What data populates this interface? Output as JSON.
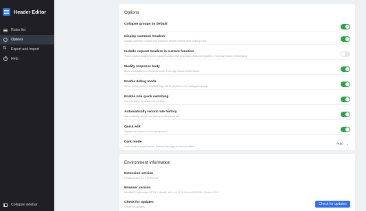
{
  "app": {
    "title": "Header Editor"
  },
  "sidebar": {
    "items": [
      {
        "label": "Rules list",
        "icon": "list-icon",
        "active": false
      },
      {
        "label": "Options",
        "icon": "gear-icon",
        "active": true
      },
      {
        "label": "Export and import",
        "icon": "swap-icon",
        "active": false
      },
      {
        "label": "Help",
        "icon": "help-icon",
        "active": false
      }
    ],
    "collapse_label": "Collapse sidebar"
  },
  "options": {
    "title": "Options",
    "items": [
      {
        "label": "Collapse groups by default",
        "desc": "",
        "enabled": true
      },
      {
        "label": "Display common headers",
        "desc": "Display common request and response header names when editing rules",
        "enabled": true
      },
      {
        "label": "Include request headers in custom function",
        "desc": "Pass request headers to the custom function that processes response headers. This may reduce performance",
        "enabled": false
      },
      {
        "label": "Modify response body",
        "desc": "Allow modification of response body. This may reduce performance",
        "enabled": true
      },
      {
        "label": "Enable debug mode",
        "desc": "When debug mode is enabled, logs will be printed on the background page",
        "enabled": true
      },
      {
        "label": "Enable rule quick switching",
        "desc": "Use the menu to switch rule content",
        "enabled": true
      },
      {
        "label": "Automatically record rule history",
        "desc": "Automatically record rule history to the switch list",
        "enabled": true
      },
      {
        "label": "Quick edit",
        "desc": "Display edit button on the popup panel",
        "enabled": true
      }
    ],
    "dark_mode": {
      "label": "Dark mode",
      "desc": "Dark mode is experimental. Refresh the page to see the effect",
      "value": "Auto"
    }
  },
  "environment": {
    "title": "Environment information",
    "extension_version": {
      "label": "Extension version",
      "value": "Header Editor 5.1.0 (firefox v3)"
    },
    "browser_version": {
      "label": "Browser version",
      "value": "Mozilla/5.0 (Windows NT 10.0; Win64; x64; rv:120.0) Gecko/20100101 Firefox/120.0"
    },
    "updates": {
      "label": "Check for updates",
      "desc": "Check for updates",
      "button": "Check for updates"
    }
  },
  "colors": {
    "accent": "#2f6ff0",
    "toggle_on": "#27a744",
    "sidebar_bg": "#1f1f24"
  }
}
